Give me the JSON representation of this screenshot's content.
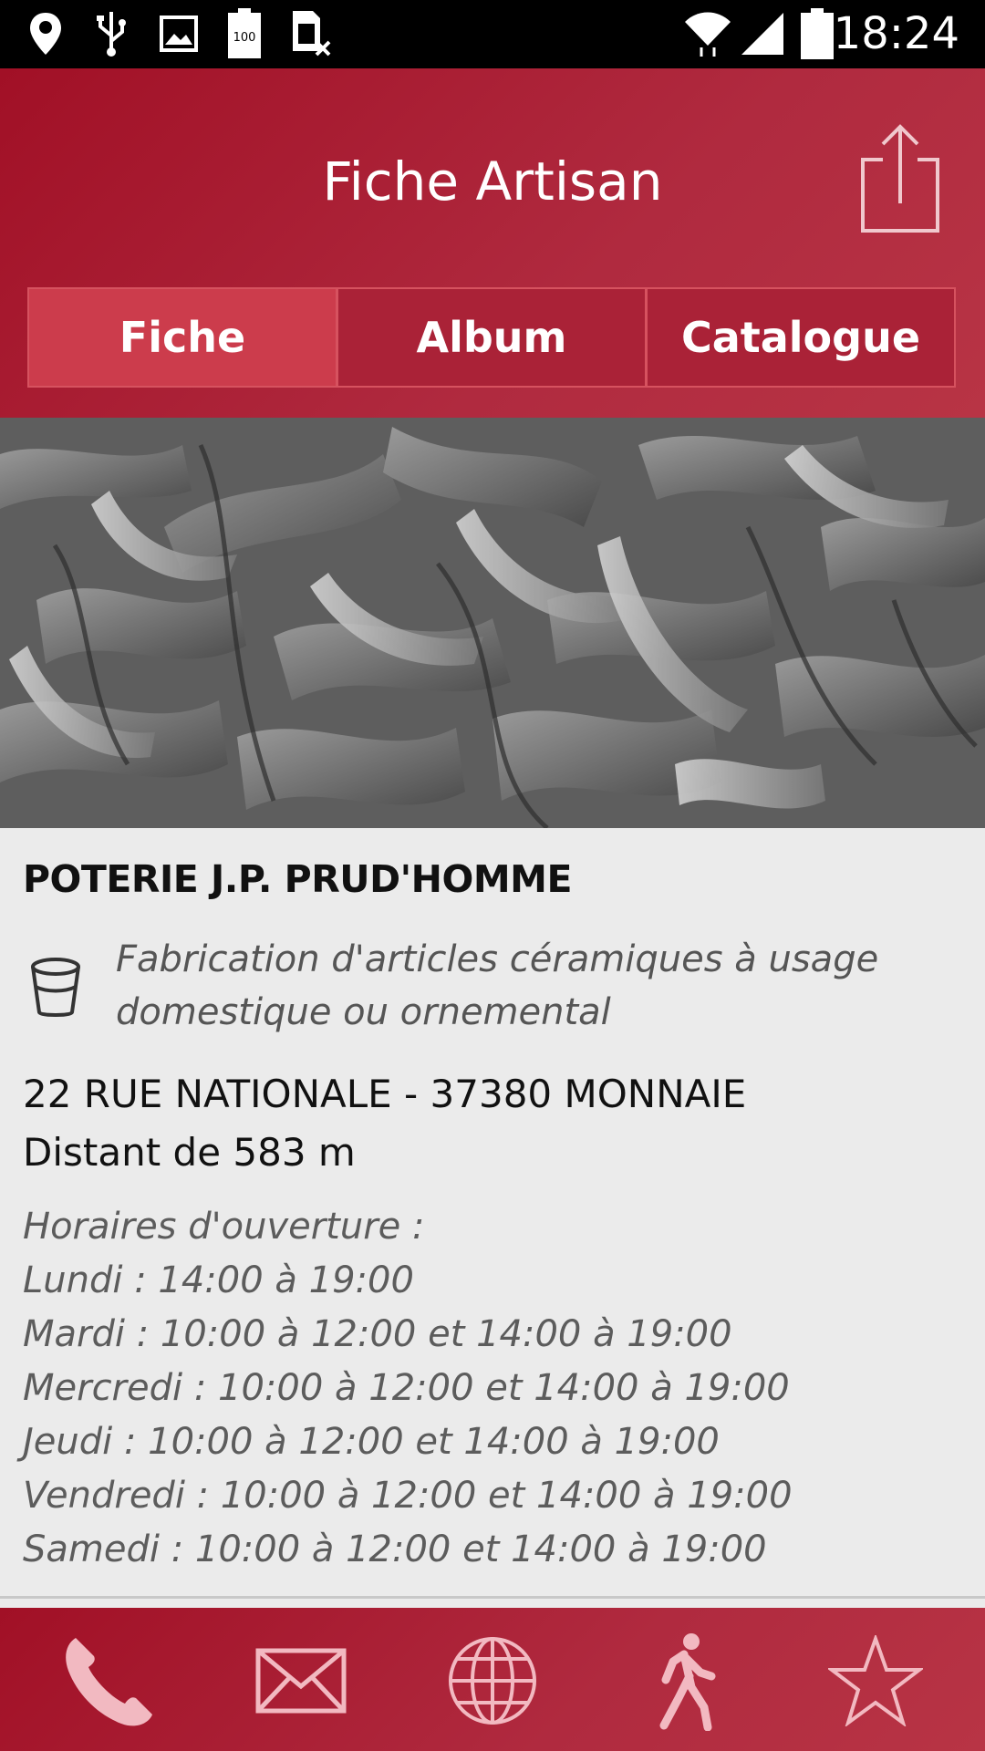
{
  "status_bar": {
    "time": "18:24",
    "battery_saver_label": "100",
    "icons": [
      "location-icon",
      "usb-icon",
      "image-icon",
      "battery-100-icon",
      "sim-off-icon",
      "wifi-icon",
      "signal-icon",
      "battery-icon"
    ]
  },
  "header": {
    "title": "Fiche Artisan",
    "share_icon": "share-icon",
    "tabs": [
      {
        "label": "Fiche",
        "active": true
      },
      {
        "label": "Album",
        "active": false
      },
      {
        "label": "Catalogue",
        "active": false
      }
    ]
  },
  "artisan": {
    "name": "POTERIE J.P. PRUD'HOMME",
    "category_icon": "pottery-cup-icon",
    "category_line1": "Fabrication d'articles céramiques à usage",
    "category_line2": "domestique ou ornemental",
    "address": "22 RUE NATIONALE - 37380 MONNAIE",
    "distance": "Distant de 583 m",
    "hours_title": "Horaires d'ouverture :",
    "hours": [
      "Lundi : 14:00 à 19:00",
      "Mardi : 10:00 à 12:00 et 14:00 à 19:00",
      "Mercredi : 10:00 à 12:00 et 14:00 à 19:00",
      "Jeudi : 10:00 à 12:00 et 14:00 à 19:00",
      "Vendredi : 10:00 à 12:00 et 14:00 à 19:00",
      "Samedi : 10:00 à 12:00 et 14:00 à 19:00"
    ]
  },
  "bottom_bar": {
    "actions": [
      "phone-icon",
      "mail-icon",
      "globe-icon",
      "walking-icon",
      "star-icon"
    ]
  },
  "colors": {
    "brand_red": "#a11026",
    "tab_active": "#cc3c4c",
    "tab_inactive": "#aa2237",
    "background": "#ebebeb"
  }
}
